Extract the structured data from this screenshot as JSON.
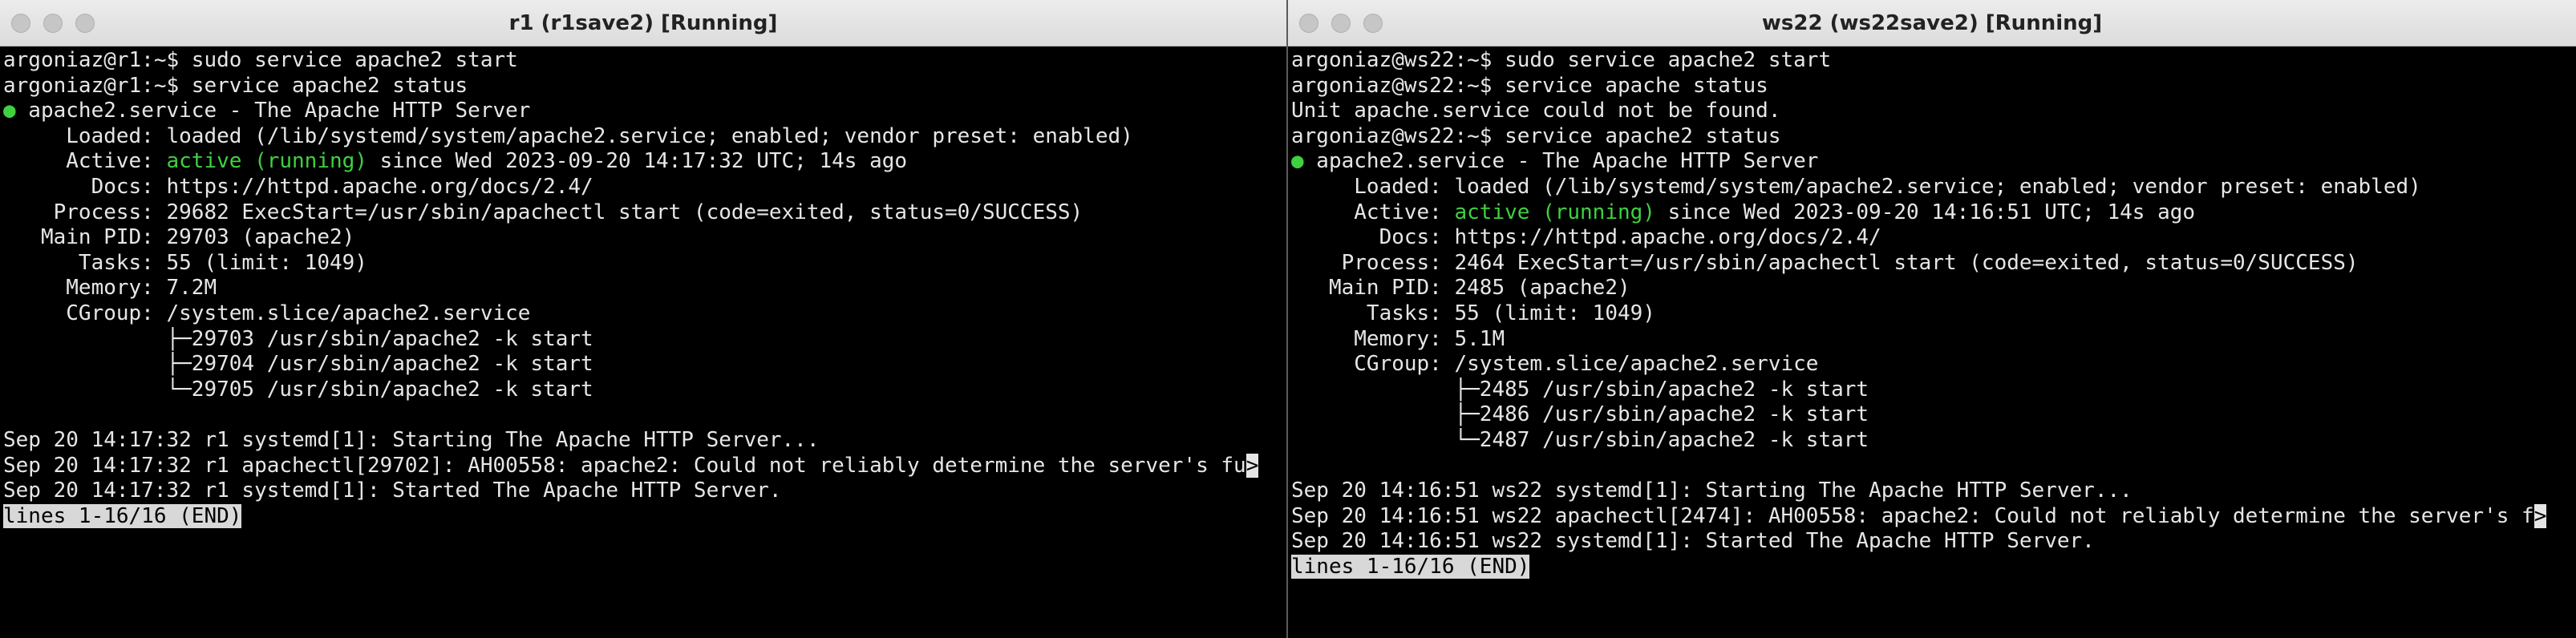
{
  "left": {
    "title": "r1 (r1save2) [Running]",
    "lines": [
      "argoniaz@r1:~$ sudo service apache2 start",
      "argoniaz@r1:~$ service apache2 status",
      {
        "dot": "●",
        "text": " apache2.service - The Apache HTTP Server"
      },
      "     Loaded: loaded (/lib/systemd/system/apache2.service; enabled; vendor preset: enabled)",
      {
        "prefix": "     Active: ",
        "status": "active (running)",
        "suffix": " since Wed 2023-09-20 14:17:32 UTC; 14s ago"
      },
      "       Docs: https://httpd.apache.org/docs/2.4/",
      "    Process: 29682 ExecStart=/usr/sbin/apachectl start (code=exited, status=0/SUCCESS)",
      "   Main PID: 29703 (apache2)",
      "      Tasks: 55 (limit: 1049)",
      "     Memory: 7.2M",
      "     CGroup: /system.slice/apache2.service",
      "             ├─29703 /usr/sbin/apache2 -k start",
      "             ├─29704 /usr/sbin/apache2 -k start",
      "             └─29705 /usr/sbin/apache2 -k start",
      "",
      "Sep 20 14:17:32 r1 systemd[1]: Starting The Apache HTTP Server...",
      {
        "text": "Sep 20 14:17:32 r1 apachectl[29702]: AH00558: apache2: Could not reliably determine the server's fu",
        "mark": ">"
      },
      "Sep 20 14:17:32 r1 systemd[1]: Started The Apache HTTP Server.",
      {
        "pager": "lines 1-16/16 (END)"
      }
    ]
  },
  "right": {
    "title": "ws22 (ws22save2) [Running]",
    "lines": [
      "argoniaz@ws22:~$ sudo service apache2 start",
      "argoniaz@ws22:~$ service apache status",
      "Unit apache.service could not be found.",
      "argoniaz@ws22:~$ service apache2 status",
      {
        "dot": "●",
        "text": " apache2.service - The Apache HTTP Server"
      },
      "     Loaded: loaded (/lib/systemd/system/apache2.service; enabled; vendor preset: enabled)",
      {
        "prefix": "     Active: ",
        "status": "active (running)",
        "suffix": " since Wed 2023-09-20 14:16:51 UTC; 14s ago"
      },
      "       Docs: https://httpd.apache.org/docs/2.4/",
      "    Process: 2464 ExecStart=/usr/sbin/apachectl start (code=exited, status=0/SUCCESS)",
      "   Main PID: 2485 (apache2)",
      "      Tasks: 55 (limit: 1049)",
      "     Memory: 5.1M",
      "     CGroup: /system.slice/apache2.service",
      "             ├─2485 /usr/sbin/apache2 -k start",
      "             ├─2486 /usr/sbin/apache2 -k start",
      "             └─2487 /usr/sbin/apache2 -k start",
      "",
      "Sep 20 14:16:51 ws22 systemd[1]: Starting The Apache HTTP Server...",
      {
        "text": "Sep 20 14:16:51 ws22 apachectl[2474]: AH00558: apache2: Could not reliably determine the server's f",
        "mark": ">"
      },
      "Sep 20 14:16:51 ws22 systemd[1]: Started The Apache HTTP Server.",
      {
        "pager": "lines 1-16/16 (END)"
      }
    ]
  },
  "colors": {
    "status_green": "#3fd13f",
    "terminal_bg": "#000000",
    "terminal_fg": "#e6e6e6"
  }
}
